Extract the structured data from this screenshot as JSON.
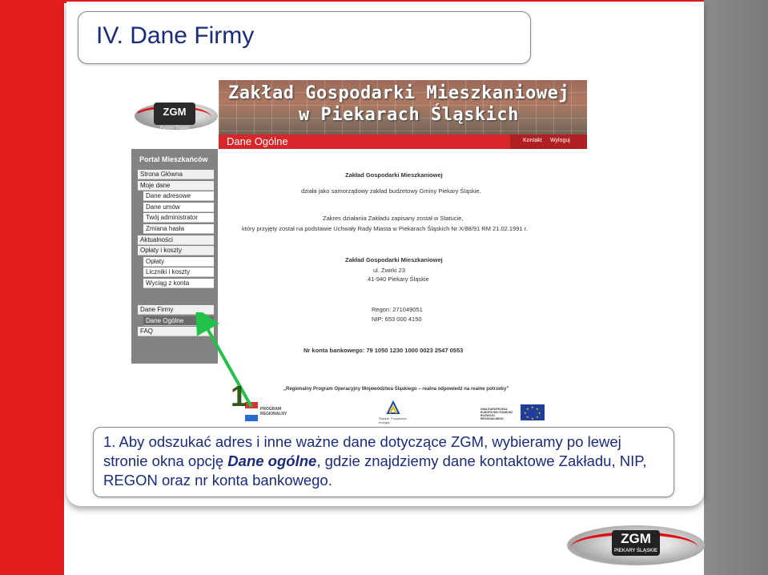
{
  "slide": {
    "title": "IV. Dane Firmy",
    "step_number": "1",
    "description_pre": "1. Aby odszukać adres i inne ważne dane dotyczące ZGM, wybieramy po lewej stronie okna opcję ",
    "description_em": "Dane ogólne",
    "description_post": ", gdzie znajdziemy dane kontaktowe Zakładu, NIP, REGON oraz nr konta bankowego."
  },
  "logo": {
    "text": "ZGM",
    "subtext": "Piekary Śląskie"
  },
  "bottom_logo": {
    "text": "ZGM",
    "subtext": "PIEKARY ŚLĄSKIE"
  },
  "banner": {
    "line1": "Zakład Gospodarki Mieszkaniowej",
    "line2": "w Piekarach Śląskich",
    "section": "Dane Ogólne",
    "links": [
      "Kontakt",
      "Wyloguj"
    ]
  },
  "sidebar": {
    "header": "Portal Mieszkańców",
    "items": [
      {
        "label": "Strona Główna",
        "sub": false,
        "selected": false
      },
      {
        "label": "Moje dane",
        "sub": false,
        "selected": false
      },
      {
        "label": "Dane adresowe",
        "sub": true,
        "selected": false
      },
      {
        "label": "Dane umów",
        "sub": true,
        "selected": false
      },
      {
        "label": "Twój administrator",
        "sub": true,
        "selected": false
      },
      {
        "label": "Zmiana hasła",
        "sub": true,
        "selected": false
      },
      {
        "label": "Aktualności",
        "sub": false,
        "selected": false
      },
      {
        "label": "Opłaty i koszty",
        "sub": false,
        "selected": false
      },
      {
        "label": "Opłaty",
        "sub": true,
        "selected": false
      },
      {
        "label": "Liczniki i koszty",
        "sub": true,
        "selected": false
      },
      {
        "label": "Wyciąg z konta",
        "sub": true,
        "selected": false
      }
    ],
    "items2": [
      {
        "label": "Dane Firmy",
        "sub": false,
        "selected": false
      },
      {
        "label": "Dane Ogólne",
        "sub": true,
        "selected": true
      },
      {
        "label": "FAQ",
        "sub": false,
        "selected": false
      }
    ]
  },
  "content": {
    "company": "Zakład Gospodarki Mieszkaniowej",
    "intro": "działa jako samorządowy zakład budżetowy Gminy Piekary Śląskie.",
    "scope1": "Zakres działania Zakładu zapisany został w Statucie,",
    "scope2": "który przyjęty został na podstawie Uchwały Rady Miasta w Piekarach Śląskich Nr X/88/91 RM 21.02.1991 r.",
    "address_name": "Zakład Gospodarki Mieszkaniowej",
    "address_street": "ul. Żwirki 23",
    "address_city": "41-940 Piekary Śląskie",
    "regon": "Regon:  271049051",
    "nip": "NIP:      653 000 4150",
    "account": "Nr konta bankowego: 79 1050 1230 1000 0023 2547 0553",
    "program": "„Regionalny Program Operacyjny Województwa Śląskiego – realna odpowiedź na realne potrzeby”",
    "footer_logo1": "PROGRAM REGIONALNY",
    "footer_logo2": "Śląskie. Pozytywna energia",
    "footer_logo3": "UNIA EUROPEJSKA EUROPEJSKI FUNDUSZ ROZWOJU REGIONALNEGO"
  }
}
